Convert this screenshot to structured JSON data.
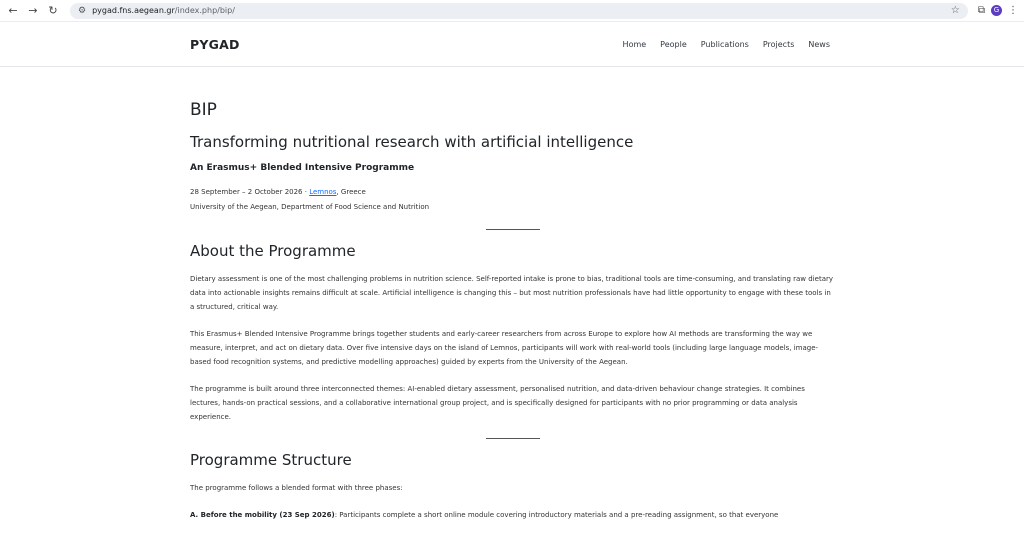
{
  "browser": {
    "url_host": "pygad.fns.aegean.gr",
    "url_path": "/index.php/bip/",
    "avatar_letter": "G"
  },
  "header": {
    "brand": "PYGAD",
    "nav": [
      "Home",
      "People",
      "Publications",
      "Projects",
      "News"
    ]
  },
  "main": {
    "title": "BIP",
    "subtitle": "Transforming nutritional research with artificial intelligence",
    "tagline": "An Erasmus+ Blended Intensive Programme",
    "dates_prefix": "28 September – 2 October 2026 · ",
    "location_link": "Lemnos",
    "location_suffix": ", Greece",
    "institution": "University of the Aegean, Department of Food Science and Nutrition",
    "about_heading": "About the Programme",
    "about_paragraphs": [
      "Dietary assessment is one of the most challenging problems in nutrition science. Self-reported intake is prone to bias, traditional tools are time-consuming, and translating raw dietary data into actionable insights remains difficult at scale. Artificial intelligence is changing this – but most nutrition professionals have had little opportunity to engage with these tools in a structured, critical way.",
      "This Erasmus+ Blended Intensive Programme brings together students and early-career researchers from across Europe to explore how AI methods are transforming the way we measure, interpret, and act on dietary data. Over five intensive days on the island of Lemnos, participants will work with real-world tools (including large language models, image-based food recognition systems, and predictive modelling approaches) guided by experts from the University of the Aegean.",
      "The programme is built around three interconnected themes: AI-enabled dietary assessment, personalised nutrition, and data-driven behaviour change strategies. It combines lectures, hands-on practical sessions, and a collaborative international group project, and is specifically designed for participants with no prior programming or data analysis experience."
    ],
    "structure_heading": "Programme Structure",
    "structure_intro": "The programme follows a blended format with three phases:",
    "phase_a_label": "A. Before the mobility (23 Sep 2026)",
    "phase_a_text": ": Participants complete a short online module covering introductory materials and a pre-reading assignment, so that everyone"
  }
}
